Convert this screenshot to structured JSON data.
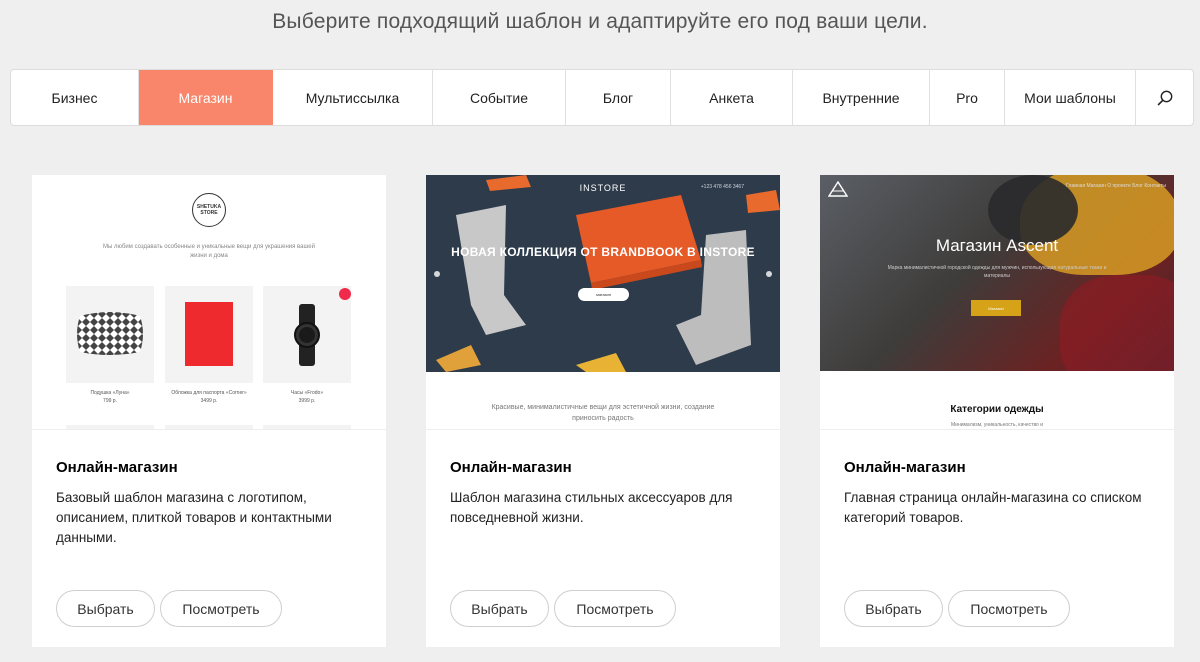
{
  "header": {
    "subtitle": "Выберите подходящий шаблон и адаптируйте его под ваши цели."
  },
  "tabs": [
    {
      "label": "Бизнес",
      "active": false
    },
    {
      "label": "Магазин",
      "active": true
    },
    {
      "label": "Мультиссылка",
      "active": false
    },
    {
      "label": "Событие",
      "active": false
    },
    {
      "label": "Блог",
      "active": false
    },
    {
      "label": "Анкета",
      "active": false
    },
    {
      "label": "Внутренние",
      "active": false
    },
    {
      "label": "Pro",
      "active": false
    },
    {
      "label": "Мои шаблоны",
      "active": false
    }
  ],
  "search": {
    "icon": "search-icon"
  },
  "accent_color": "#f9866a",
  "cards": [
    {
      "title": "Онлайн-магазин",
      "description": "Базовый шаблон магазина с логотипом, описанием, плиткой товаров и контактными данными.",
      "select_label": "Выбрать",
      "view_label": "Посмотреть",
      "preview": {
        "logo": "SHETUKA STORE",
        "tagline": "Мы любим создавать особенные и уникальные вещи для украшения вашей жизни и дома",
        "products": [
          {
            "name": "Подушка «Луна»",
            "price": "799 р."
          },
          {
            "name": "Обложка для паспорта «Corner»",
            "price": "3499 р."
          },
          {
            "name": "Часы «Frodo»",
            "price": "3999 р."
          }
        ]
      }
    },
    {
      "title": "Онлайн-магазин",
      "description": "Шаблон магазина стильных аксессуаров для повседневной жизни.",
      "select_label": "Выбрать",
      "view_label": "Посмотреть",
      "preview": {
        "brand": "INSTORE",
        "contact": "+123 478 456 3467",
        "headline": "НОВАЯ КОЛЛЕКЦИЯ ОТ BRANDBOOK В INSTORE",
        "button": "магазин",
        "footer_text": "Красивые, минималистичные вещи для эстетичной жизни, создание приносить радость"
      }
    },
    {
      "title": "Онлайн-магазин",
      "description": "Главная страница онлайн-магазина со списком категорий товаров.",
      "select_label": "Выбрать",
      "view_label": "Посмотреть",
      "preview": {
        "nav": "Главная   Магазин   О проекте   Блог   Контакты",
        "title": "Магазин Ascent",
        "desc": "Марка минималистичной городской одежды для мужчин, использующая натуральные ткани и материалы",
        "button": "Магазин",
        "category_title": "Категории одежды",
        "category_sub": "Минимализм, уникальность, качество и"
      }
    }
  ]
}
